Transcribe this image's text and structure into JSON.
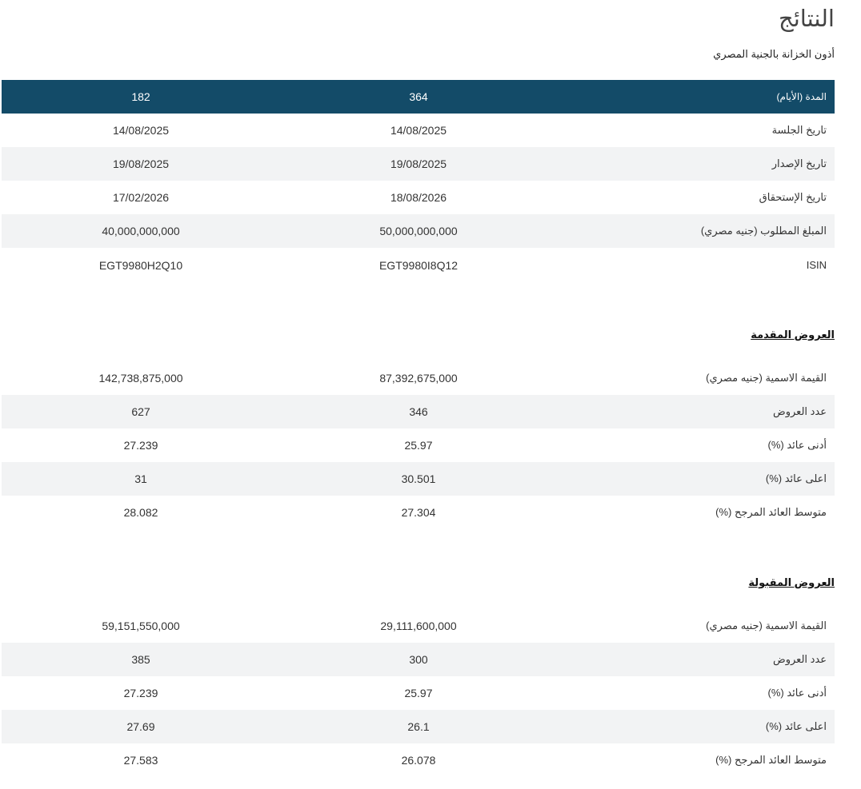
{
  "page": {
    "title": "النتائج",
    "subtitle": "أذون الخزانة بالجنية المصري"
  },
  "tenor": {
    "label": "المدة (الأيام)",
    "col_a": "364",
    "col_b": "182"
  },
  "auction_rows": [
    {
      "label": "تاريخ الجلسة",
      "col_a": "14/08/2025",
      "col_b": "14/08/2025"
    },
    {
      "label": "تاريخ الإصدار",
      "col_a": "19/08/2025",
      "col_b": "19/08/2025"
    },
    {
      "label": "تاريخ الإستحقاق",
      "col_a": "18/08/2026",
      "col_b": "17/02/2026"
    },
    {
      "label": "المبلغ المطلوب (جنيه مصري)",
      "col_a": "50,000,000,000",
      "col_b": "40,000,000,000"
    },
    {
      "label": "ISIN",
      "col_a": "EGT9980I8Q12",
      "col_b": "EGT9980H2Q10"
    }
  ],
  "submitted": {
    "heading": "العروض المقدمة",
    "rows": [
      {
        "label": "القيمة الاسمية (جنيه مصري)",
        "col_a": "87,392,675,000",
        "col_b": "142,738,875,000"
      },
      {
        "label": "عدد العروض",
        "col_a": "346",
        "col_b": "627"
      },
      {
        "label": "أدنى عائد (%)",
        "col_a": "25.97",
        "col_b": "27.239"
      },
      {
        "label": "اعلى عائد (%)",
        "col_a": "30.501",
        "col_b": "31"
      },
      {
        "label": "متوسط العائد المرجح (%)",
        "col_a": "27.304",
        "col_b": "28.082"
      }
    ]
  },
  "accepted": {
    "heading": "العروض المقبولة",
    "rows": [
      {
        "label": "القيمة الاسمية (جنيه مصري)",
        "col_a": "29,111,600,000",
        "col_b": "59,151,550,000"
      },
      {
        "label": "عدد العروض",
        "col_a": "300",
        "col_b": "385"
      },
      {
        "label": "أدنى عائد (%)",
        "col_a": "25.97",
        "col_b": "27.239"
      },
      {
        "label": "اعلى عائد (%)",
        "col_a": "26.1",
        "col_b": "27.69"
      },
      {
        "label": "متوسط العائد المرجح (%)",
        "col_a": "26.078",
        "col_b": "27.583"
      }
    ]
  },
  "colors": {
    "header_background": "#134b68",
    "stripe_background": "#f2f3f4"
  }
}
